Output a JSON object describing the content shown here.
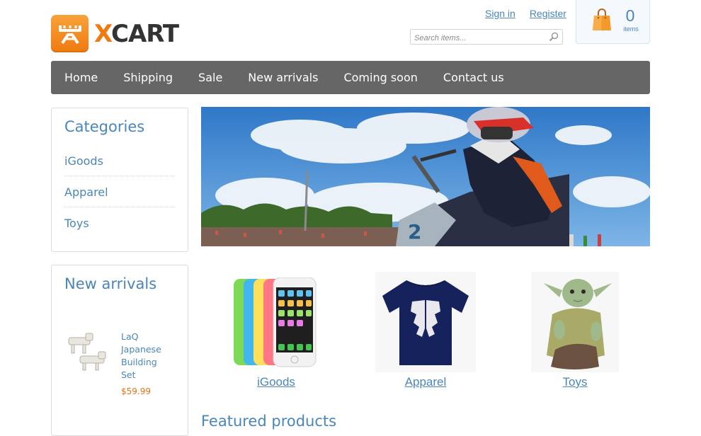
{
  "header": {
    "logo_text_x": "X",
    "logo_text_rest": "CART",
    "sign_in": "Sign in",
    "register": "Register",
    "search_placeholder": "Search items...",
    "cart_count": "0",
    "cart_items_label": "items"
  },
  "nav": {
    "items": [
      "Home",
      "Shipping",
      "Sale",
      "New arrivals",
      "Coming soon",
      "Contact us"
    ]
  },
  "sidebar": {
    "categories_title": "Categories",
    "categories": [
      "iGoods",
      "Apparel",
      "Toys"
    ],
    "new_arrivals_title": "New arrivals",
    "new_arrival_product": {
      "name": "LaQ Japanese Building Set",
      "price": "$59.99"
    }
  },
  "main": {
    "category_tiles": [
      "iGoods",
      "Apparel",
      "Toys"
    ],
    "featured_heading": "Featured products"
  },
  "colors": {
    "accent": "#4a86b8",
    "logo_orange": "#ef7a10",
    "nav_bg": "#666666",
    "price": "#e8731d"
  },
  "icons": [
    "xcart-logo-icon",
    "search-icon",
    "shopping-bag-icon"
  ]
}
